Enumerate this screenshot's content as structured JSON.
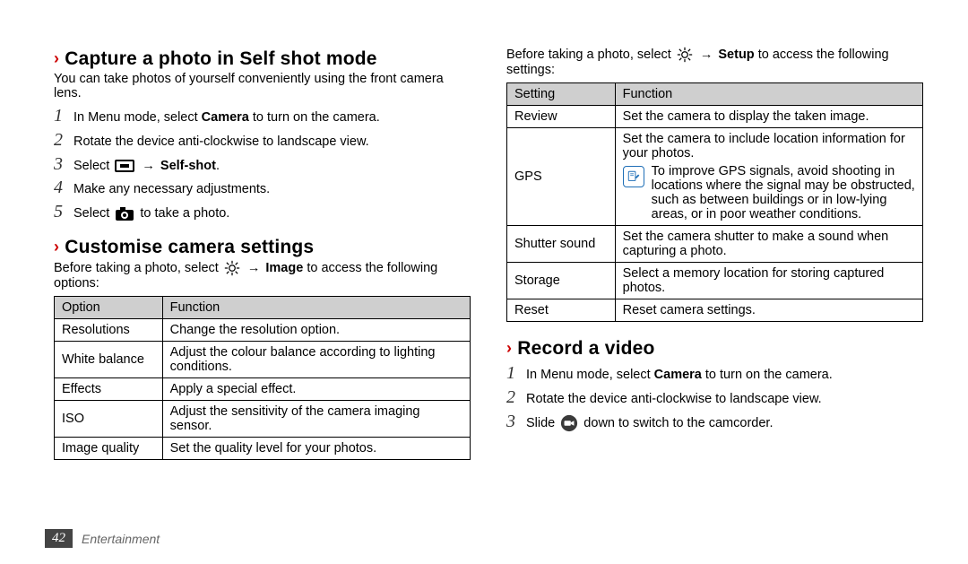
{
  "left": {
    "section1": {
      "title": "Capture a photo in Self shot mode",
      "intro": "You can take photos of yourself conveniently using the front camera lens.",
      "steps": [
        {
          "n": "1",
          "pre": "In Menu mode, select ",
          "bold": "Camera",
          "post": " to turn on the camera."
        },
        {
          "n": "2",
          "pre": "Rotate the device anti-clockwise to landscape view.",
          "bold": "",
          "post": ""
        },
        {
          "n": "3",
          "pre": "Select ",
          "icon": "menu-rect-icon",
          "mid": " → ",
          "bold": "Self-shot",
          "post": "."
        },
        {
          "n": "4",
          "pre": "Make any necessary adjustments.",
          "bold": "",
          "post": ""
        },
        {
          "n": "5",
          "pre": "Select ",
          "icon": "camera-shutter-icon",
          "post": " to take a photo."
        }
      ]
    },
    "section2": {
      "title": "Customise camera settings",
      "intro_pre": "Before taking a photo, select ",
      "intro_icon": "settings-gear-icon",
      "intro_mid": " → ",
      "intro_bold": "Image",
      "intro_post": " to access the following options:",
      "table": {
        "head": {
          "a": "Option",
          "b": "Function"
        },
        "rows": [
          {
            "a": "Resolutions",
            "b": "Change the resolution option."
          },
          {
            "a": "White balance",
            "b": "Adjust the colour balance according to lighting conditions."
          },
          {
            "a": "Effects",
            "b": "Apply a special effect."
          },
          {
            "a": "ISO",
            "b": "Adjust the sensitivity of the camera imaging sensor."
          },
          {
            "a": "Image quality",
            "b": "Set the quality level for your photos."
          }
        ]
      }
    }
  },
  "right": {
    "intro_pre": "Before taking a photo, select ",
    "intro_icon": "settings-gear-icon",
    "intro_mid": " → ",
    "intro_bold": "Setup",
    "intro_post": " to access the following settings:",
    "table": {
      "head": {
        "a": "Setting",
        "b": "Function"
      },
      "rows": [
        {
          "a": "Review",
          "b": "Set the camera to display the taken image."
        },
        {
          "a": "GPS",
          "b": "Set the camera to include location information for your photos.",
          "note": "To improve GPS signals, avoid shooting in locations where the signal may be obstructed, such as between buildings or in low-lying areas, or in poor weather conditions."
        },
        {
          "a": "Shutter sound",
          "b": "Set the camera shutter to make a sound when capturing a photo."
        },
        {
          "a": "Storage",
          "b": "Select a memory location for storing captured photos."
        },
        {
          "a": "Reset",
          "b": "Reset camera settings."
        }
      ]
    },
    "section2": {
      "title": "Record a video",
      "steps": [
        {
          "n": "1",
          "pre": "In Menu mode, select ",
          "bold": "Camera",
          "post": " to turn on the camera."
        },
        {
          "n": "2",
          "pre": "Rotate the device anti-clockwise to landscape view.",
          "bold": "",
          "post": ""
        },
        {
          "n": "3",
          "pre": "Slide ",
          "icon": "camcorder-toggle-icon",
          "post": " down to switch to the camcorder."
        }
      ]
    }
  },
  "footer": {
    "page": "42",
    "chapter": "Entertainment"
  }
}
